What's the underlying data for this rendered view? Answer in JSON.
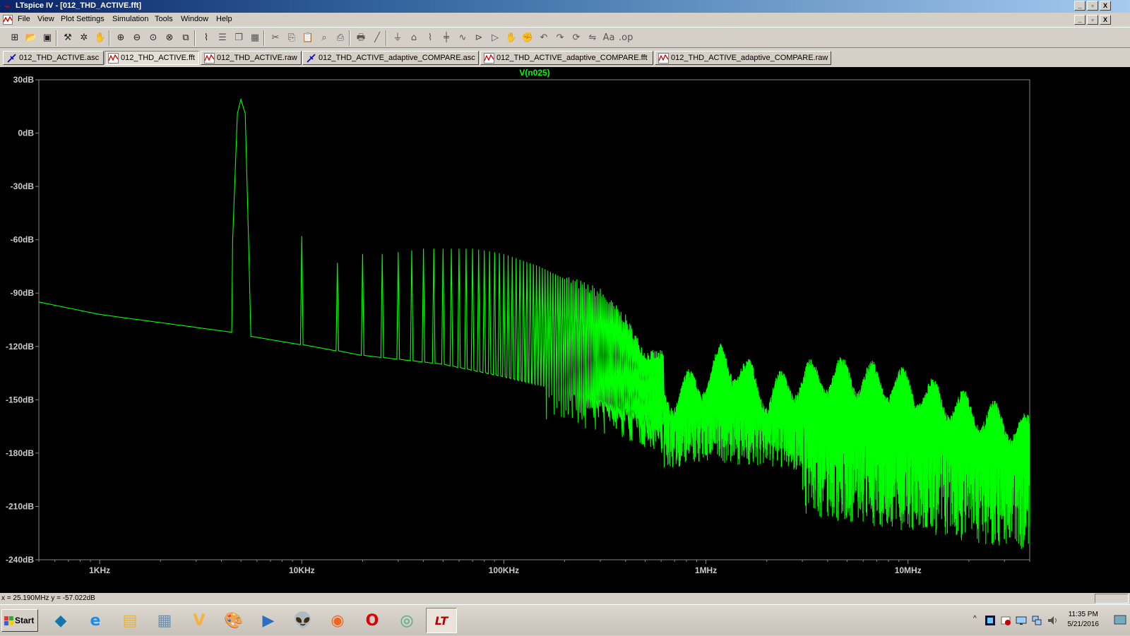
{
  "window": {
    "title": "LTspice IV - [012_THD_ACTIVE.fft]",
    "controls": [
      "_",
      "▫",
      "X"
    ]
  },
  "menu": {
    "items": [
      {
        "label": "File",
        "hotkey": "F"
      },
      {
        "label": "View",
        "hotkey": "V"
      },
      {
        "label": "Plot Settings",
        "hotkey": "P"
      },
      {
        "label": "Simulation",
        "hotkey": "S"
      },
      {
        "label": "Tools",
        "hotkey": "T"
      },
      {
        "label": "Window",
        "hotkey": "W"
      },
      {
        "label": "Help",
        "hotkey": "H"
      }
    ]
  },
  "toolbar": {
    "icons": [
      "new-schematic-icon",
      "open-icon",
      "save-icon",
      "control-panel-icon",
      "run-icon",
      "halt-icon",
      "zoom-in-icon",
      "zoom-out-icon",
      "zoom-fit-icon",
      "zoom-cancel-icon",
      "autorange-icon",
      "waveform-icon",
      "tile-horizontal-icon",
      "cascade-icon",
      "tile-icon",
      "cut-icon",
      "copy-icon",
      "paste-icon",
      "find-icon",
      "print-preview-icon",
      "print-icon",
      "wire-icon",
      "ground-icon",
      "label-icon",
      "resistor-icon",
      "capacitor-icon",
      "inductor-icon",
      "diode-icon",
      "component-icon",
      "move-icon",
      "drag-icon",
      "undo-icon",
      "redo-icon",
      "rotate-icon",
      "mirror-icon",
      "text-icon",
      "spice-directive-icon"
    ]
  },
  "tabs": [
    {
      "label": "012_THD_ACTIVE.asc",
      "kind": "schematic",
      "active": false
    },
    {
      "label": "012_THD_ACTIVE.fft",
      "kind": "waveform",
      "active": true
    },
    {
      "label": "012_THD_ACTIVE.raw",
      "kind": "waveform",
      "active": false
    },
    {
      "label": "012_THD_ACTIVE_adaptive_COMPARE.asc",
      "kind": "schematic",
      "active": false
    },
    {
      "label": "012_THD_ACTIVE_adaptive_COMPARE.fft",
      "kind": "waveform",
      "active": false
    },
    {
      "label": "012_THD_ACTIVE_adaptive_COMPARE.raw",
      "kind": "waveform",
      "active": false
    }
  ],
  "chart_data": {
    "type": "line",
    "title": "V(n025)",
    "xscale": "log",
    "xlim": [
      500,
      40000000
    ],
    "ylim": [
      -240,
      30
    ],
    "yticks": [
      30,
      0,
      -30,
      -60,
      -90,
      -120,
      -150,
      -180,
      -210,
      -240
    ],
    "ytick_labels": [
      "30dB",
      "0dB",
      "-30dB",
      "-60dB",
      "-90dB",
      "-120dB",
      "-150dB",
      "-180dB",
      "-210dB",
      "-240dB"
    ],
    "xticks": [
      1000,
      10000,
      100000,
      1000000,
      10000000
    ],
    "xtick_labels": [
      "1KHz",
      "10KHz",
      "100KHz",
      "1MHz",
      "10MHz"
    ],
    "series": [
      {
        "name": "V(n025)",
        "color": "#00ff00",
        "fundamental": {
          "freq": 5000,
          "db": 19
        },
        "harmonic_peaks": [
          {
            "freq": 10000,
            "db": -58
          },
          {
            "freq": 15000,
            "db": -73
          },
          {
            "freq": 20000,
            "db": -68
          },
          {
            "freq": 25000,
            "db": -68
          },
          {
            "freq": 30000,
            "db": -67
          },
          {
            "freq": 35000,
            "db": -66
          },
          {
            "freq": 40000,
            "db": -65
          },
          {
            "freq": 45000,
            "db": -65
          },
          {
            "freq": 50000,
            "db": -65
          },
          {
            "freq": 60000,
            "db": -65
          },
          {
            "freq": 70000,
            "db": -65
          },
          {
            "freq": 80000,
            "db": -66
          },
          {
            "freq": 100000,
            "db": -68
          },
          {
            "freq": 150000,
            "db": -75
          },
          {
            "freq": 200000,
            "db": -82
          },
          {
            "freq": 300000,
            "db": -90
          },
          {
            "freq": 400000,
            "db": -105
          },
          {
            "freq": 500000,
            "db": -125
          }
        ],
        "noise_floor": [
          {
            "freq": 500,
            "db": -95
          },
          {
            "freq": 1000,
            "db": -102
          },
          {
            "freq": 4500,
            "db": -112
          },
          {
            "freq": 6000,
            "db": -115
          },
          {
            "freq": 10000,
            "db": -119
          },
          {
            "freq": 20000,
            "db": -125
          },
          {
            "freq": 50000,
            "db": -130
          },
          {
            "freq": 100000,
            "db": -137
          },
          {
            "freq": 300000,
            "db": -150
          },
          {
            "freq": 600000,
            "db": -160
          },
          {
            "freq": 1000000,
            "db": -155
          },
          {
            "freq": 3000000,
            "db": -160
          },
          {
            "freq": 10000000,
            "db": -170
          },
          {
            "freq": 40000000,
            "db": -180
          }
        ],
        "hf_envelope": [
          {
            "freq": 700000,
            "db": -140
          },
          {
            "freq": 1000000,
            "db": -130
          },
          {
            "freq": 1200000,
            "db": -120
          },
          {
            "freq": 1500000,
            "db": -125
          },
          {
            "freq": 2000000,
            "db": -140
          },
          {
            "freq": 3000000,
            "db": -130
          },
          {
            "freq": 5000000,
            "db": -128
          },
          {
            "freq": 10000000,
            "db": -135
          },
          {
            "freq": 20000000,
            "db": -148
          },
          {
            "freq": 40000000,
            "db": -160
          }
        ]
      }
    ]
  },
  "status": {
    "cursor_readout": "x = 25.190MHz    y = -57.022dB"
  },
  "taskbar": {
    "start_label": "Start",
    "apps": [
      "kodi-icon",
      "internet-explorer-icon",
      "file-explorer-icon",
      "calculator-icon",
      "vivaldi-icon",
      "paint-icon",
      "media-player-icon",
      "alienware-icon",
      "firefox-icon",
      "opera-icon",
      "chrome-icon",
      "ltspice-icon"
    ],
    "clock_time": "11:35 PM",
    "clock_date": "5/21/2016"
  }
}
